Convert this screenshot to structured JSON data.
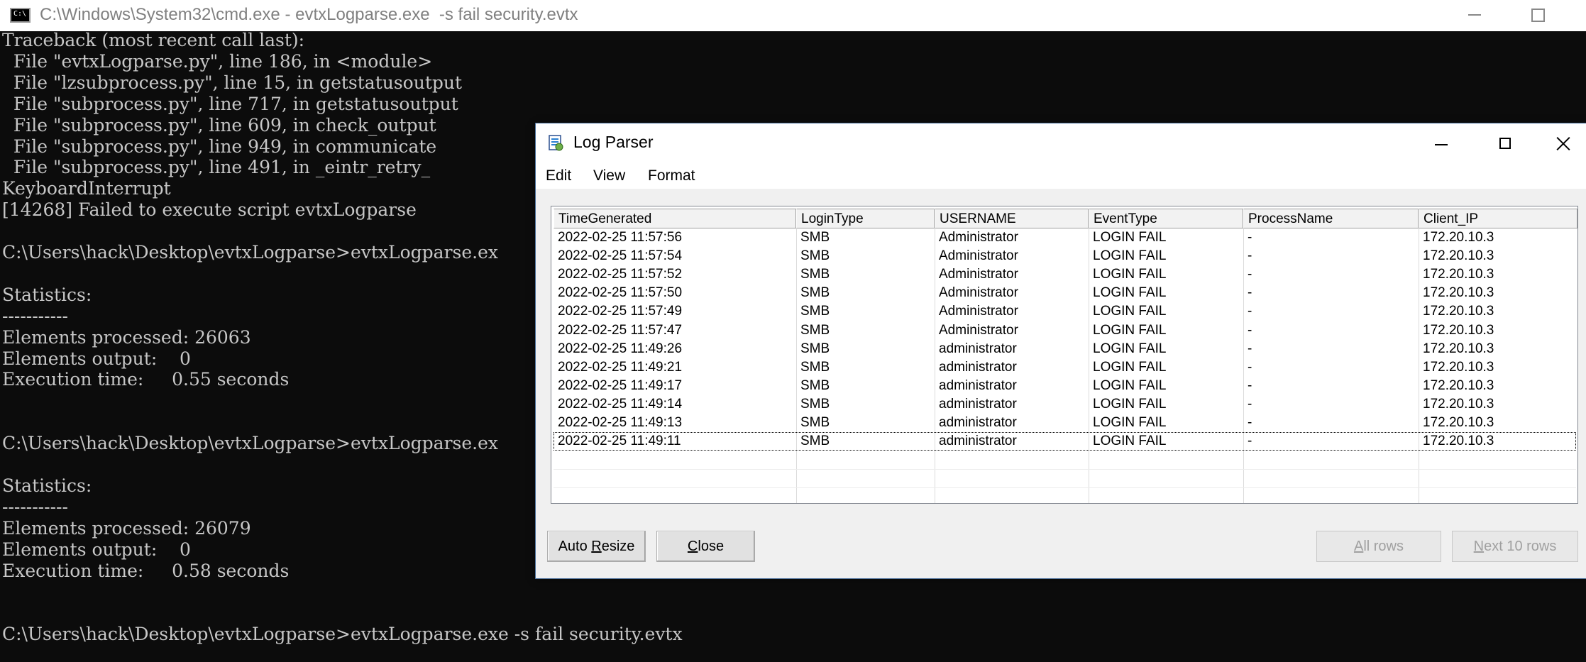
{
  "cmd": {
    "title": "C:\\Windows\\System32\\cmd.exe - evtxLogparse.exe  -s fail security.evtx",
    "icon": "console-icon",
    "lines": [
      "Traceback (most recent call last):",
      "  File \"evtxLogparse.py\", line 186, in <module>",
      "  File \"lzsubprocess.py\", line 15, in getstatusoutput",
      "  File \"subprocess.py\", line 717, in getstatusoutput",
      "  File \"subprocess.py\", line 609, in check_output",
      "  File \"subprocess.py\", line 949, in communicate",
      "  File \"subprocess.py\", line 491, in _eintr_retry_",
      "KeyboardInterrupt",
      "[14268] Failed to execute script evtxLogparse",
      "",
      "C:\\Users\\hack\\Desktop\\evtxLogparse>evtxLogparse.ex",
      "",
      "Statistics:",
      "-----------",
      "Elements processed: 26063",
      "Elements output:    0",
      "Execution time:     0.55 seconds",
      "",
      "",
      "C:\\Users\\hack\\Desktop\\evtxLogparse>evtxLogparse.ex",
      "",
      "Statistics:",
      "-----------",
      "Elements processed: 26079",
      "Elements output:    0",
      "Execution time:     0.58 seconds",
      "",
      "",
      "C:\\Users\\hack\\Desktop\\evtxLogparse>evtxLogparse.exe -s fail security.evtx"
    ]
  },
  "logparser": {
    "title": "Log Parser",
    "icon": "log-parser-icon",
    "menu": {
      "edit": "Edit",
      "view": "View",
      "format": "Format"
    },
    "columns": [
      "TimeGenerated",
      "LoginType",
      "USERNAME",
      "EventType",
      "ProcessName",
      "Client_IP"
    ],
    "rows": [
      [
        "2022-02-25 11:57:56",
        "SMB",
        "Administrator",
        "LOGIN FAIL",
        "-",
        "172.20.10.3"
      ],
      [
        "2022-02-25 11:57:54",
        "SMB",
        "Administrator",
        "LOGIN FAIL",
        "-",
        "172.20.10.3"
      ],
      [
        "2022-02-25 11:57:52",
        "SMB",
        "Administrator",
        "LOGIN FAIL",
        "-",
        "172.20.10.3"
      ],
      [
        "2022-02-25 11:57:50",
        "SMB",
        "Administrator",
        "LOGIN FAIL",
        "-",
        "172.20.10.3"
      ],
      [
        "2022-02-25 11:57:49",
        "SMB",
        "Administrator",
        "LOGIN FAIL",
        "-",
        "172.20.10.3"
      ],
      [
        "2022-02-25 11:57:47",
        "SMB",
        "Administrator",
        "LOGIN FAIL",
        "-",
        "172.20.10.3"
      ],
      [
        "2022-02-25 11:49:26",
        "SMB",
        "administrator",
        "LOGIN FAIL",
        "-",
        "172.20.10.3"
      ],
      [
        "2022-02-25 11:49:21",
        "SMB",
        "administrator",
        "LOGIN FAIL",
        "-",
        "172.20.10.3"
      ],
      [
        "2022-02-25 11:49:17",
        "SMB",
        "administrator",
        "LOGIN FAIL",
        "-",
        "172.20.10.3"
      ],
      [
        "2022-02-25 11:49:14",
        "SMB",
        "administrator",
        "LOGIN FAIL",
        "-",
        "172.20.10.3"
      ],
      [
        "2022-02-25 11:49:13",
        "SMB",
        "administrator",
        "LOGIN FAIL",
        "-",
        "172.20.10.3"
      ],
      [
        "2022-02-25 11:49:11",
        "SMB",
        "administrator",
        "LOGIN FAIL",
        "-",
        "172.20.10.3"
      ]
    ],
    "buttons": {
      "auto_resize": "Auto Resize",
      "close": "Close",
      "all_rows": "All rows",
      "next_rows": "Next 10 rows"
    }
  }
}
